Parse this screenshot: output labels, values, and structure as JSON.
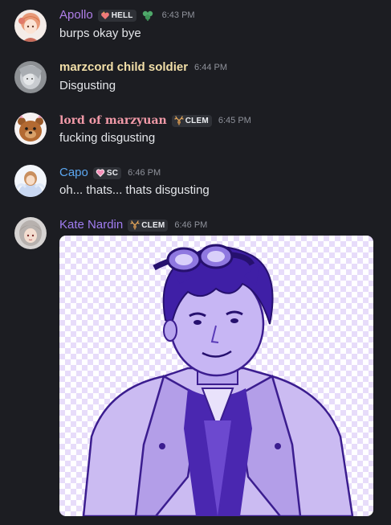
{
  "messages": [
    {
      "username": "Apollo",
      "username_color": "#b07fe8",
      "tag": "HELL",
      "tag_icon": "flame-heart-icon",
      "extra_icon": "clover-icon",
      "time": "6:43 PM",
      "text": "burps okay bye"
    },
    {
      "username": "marzcord child soldier",
      "username_color": "#f2dfa8",
      "time": "6:44 PM",
      "text": "Disgusting"
    },
    {
      "username": "lord of marzyuan",
      "username_color": "#f29aa8",
      "tag": "CLEM",
      "tag_icon": "antlers-icon",
      "time": "6:45 PM",
      "text": "fucking disgusting"
    },
    {
      "username": "Capo",
      "username_color": "#5ca7f0",
      "tag": "SC",
      "tag_icon": "heart-icon",
      "time": "6:46 PM",
      "text": "oh... thats... thats disgusting"
    },
    {
      "username": "Kate Nardin",
      "username_color": "#a07cf0",
      "tag": "CLEM",
      "tag_icon": "antlers-icon",
      "time": "6:46 PM",
      "attachment": "purple-tinted-character-image"
    }
  ],
  "colors": {
    "background": "#1c1d22",
    "text": "#e3e5e9",
    "timestamp": "#8f929b",
    "tag_bg": "#2f3137",
    "image_tint": "#5b2fc9"
  }
}
